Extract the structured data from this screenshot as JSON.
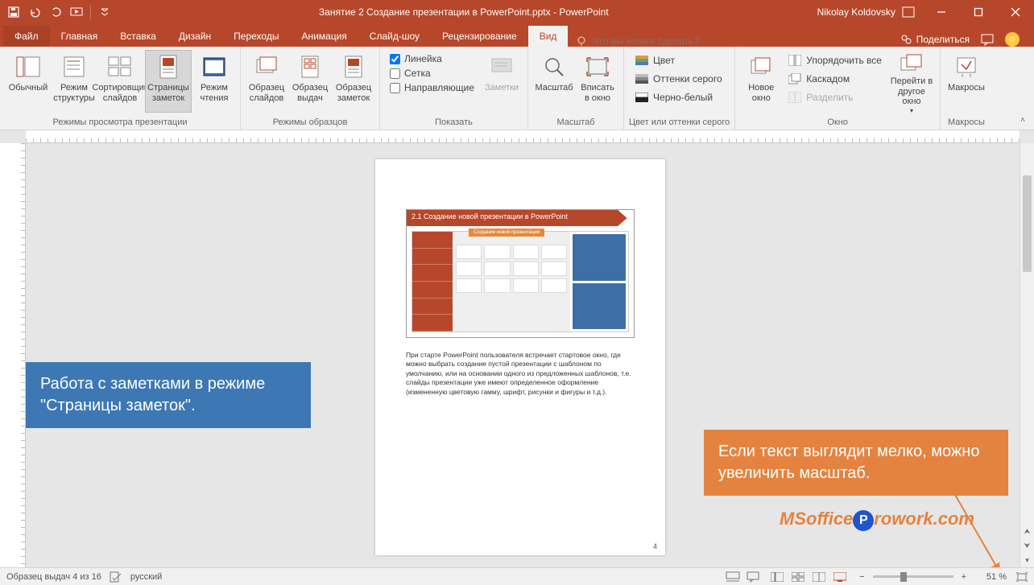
{
  "title": {
    "doc": "Занятие 2 Создание презентации в PowerPoint.pptx",
    "app": "PowerPoint"
  },
  "user": "Nikolay Koldovsky",
  "tabs": {
    "file": "Файл",
    "home": "Главная",
    "insert": "Вставка",
    "design": "Дизайн",
    "transitions": "Переходы",
    "animations": "Анимация",
    "slideshow": "Слайд-шоу",
    "review": "Рецензирование",
    "view": "Вид"
  },
  "tellme": "Что вы хотите сделать?",
  "share": "Поделиться",
  "groups": {
    "g1": {
      "label": "Режимы просмотра презентации",
      "b": {
        "normal": "Обычный",
        "outline": "Режим\nструктуры",
        "sorter": "Сортировщик\nслайдов",
        "notes": "Страницы\nзаметок",
        "reading": "Режим\nчтения"
      }
    },
    "g2": {
      "label": "Режимы образцов",
      "b": {
        "slide": "Образец\nслайдов",
        "handout": "Образец\nвыдач",
        "noteM": "Образец\nзаметок"
      }
    },
    "g3": {
      "label": "Показать",
      "chk": {
        "ruler": "Линейка",
        "grid": "Сетка",
        "guides": "Направляющие"
      },
      "notesBtn": "Заметки"
    },
    "g4": {
      "label": "Масштаб",
      "b": {
        "zoom": "Масштаб",
        "fit": "Вписать\nв окно"
      }
    },
    "g5": {
      "label": "Цвет или оттенки серого",
      "b": {
        "color": "Цвет",
        "gray": "Оттенки серого",
        "bw": "Черно-белый"
      }
    },
    "g6": {
      "label": "Окно",
      "b": {
        "new": "Новое\nокно",
        "arrange": "Упорядочить все",
        "cascade": "Каскадом",
        "split": "Разделить",
        "switch": "Перейти в\nдругое окно"
      }
    },
    "g7": {
      "label": "Макросы",
      "b": {
        "macros": "Макросы"
      }
    }
  },
  "slide": {
    "title": "2.1 Создание новой презентации в PowerPoint",
    "sub": "Создание новой презентации"
  },
  "notesText": "При старте PowerPoint пользователя встречает стартовое окно, где можно выбрать создание пустой презентации с шаблоном по умолчанию, или на основании одного из предложенных шаблонов, т.е. слайды презентации уже имеют определенное оформление (измененную цветовую гамму, шрифт, рисунки и фигуры и т.д.).",
  "pageNum": "4",
  "annot": {
    "blue": "Работа с заметками в режиме \"Страницы заметок\".",
    "orange": "Если текст выглядит мелко, можно увеличить масштаб."
  },
  "logo": {
    "a": "MSoffice",
    "b": "rowork.com"
  },
  "status": {
    "left": "Образец выдач 4 из 16",
    "lang": "русский",
    "zoom": "51 %"
  }
}
